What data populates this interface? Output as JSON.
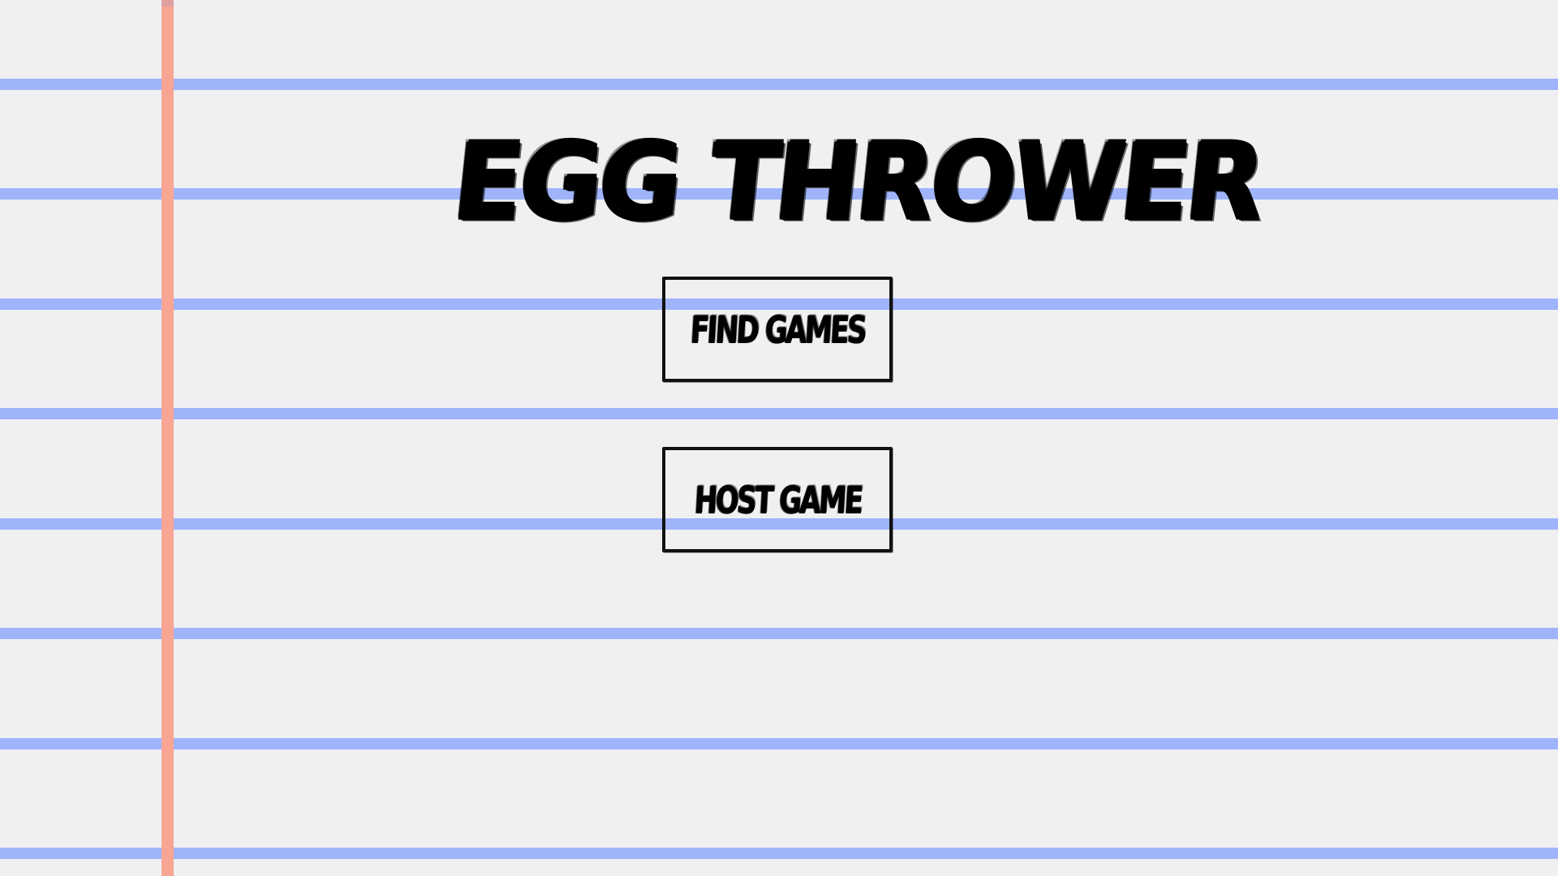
{
  "game": {
    "title": "EGG THROWER",
    "menu": {
      "find_games_label": "FIND GAMES",
      "host_game_label": "HOST GAME"
    }
  },
  "colors": {
    "paper_background": "#f0f0f2",
    "rule_line": "#9fb4fa",
    "margin_line": "#f8a594",
    "ink": "#000000"
  }
}
